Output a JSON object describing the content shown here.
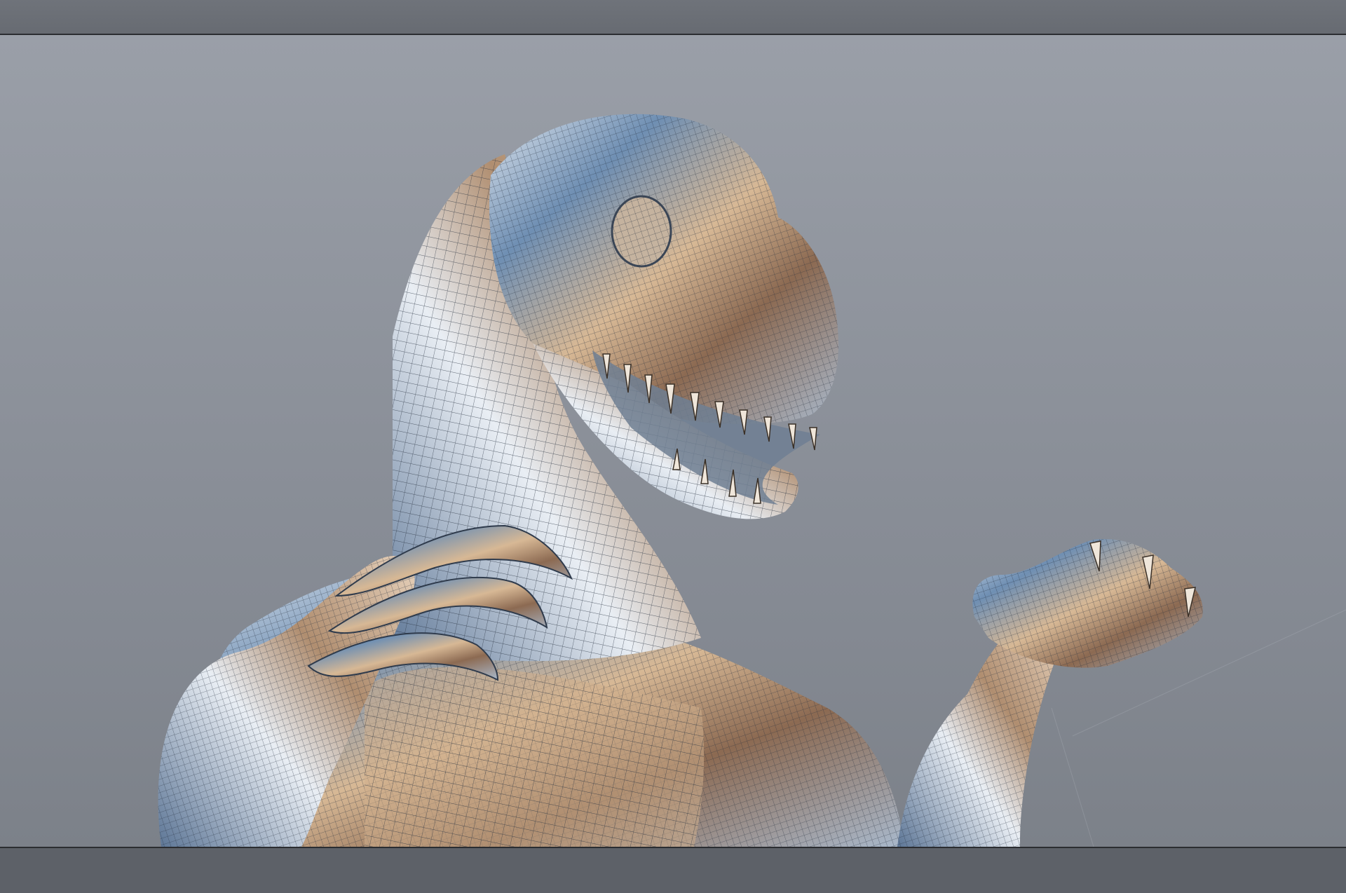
{
  "app": {
    "viewport_label": "",
    "colors": {
      "background_top": "#9a9fa8",
      "background_bottom": "#7c8189",
      "bar": "#6b6f76",
      "bar_edge": "#2b2d31",
      "mesh_warm": "#c9a98a",
      "mesh_cool": "#6f8fb3",
      "wire": "#2a3446"
    }
  },
  "scene": {
    "subject": "dinosaur-model",
    "display_mode": "wireframe-on-shaded"
  }
}
